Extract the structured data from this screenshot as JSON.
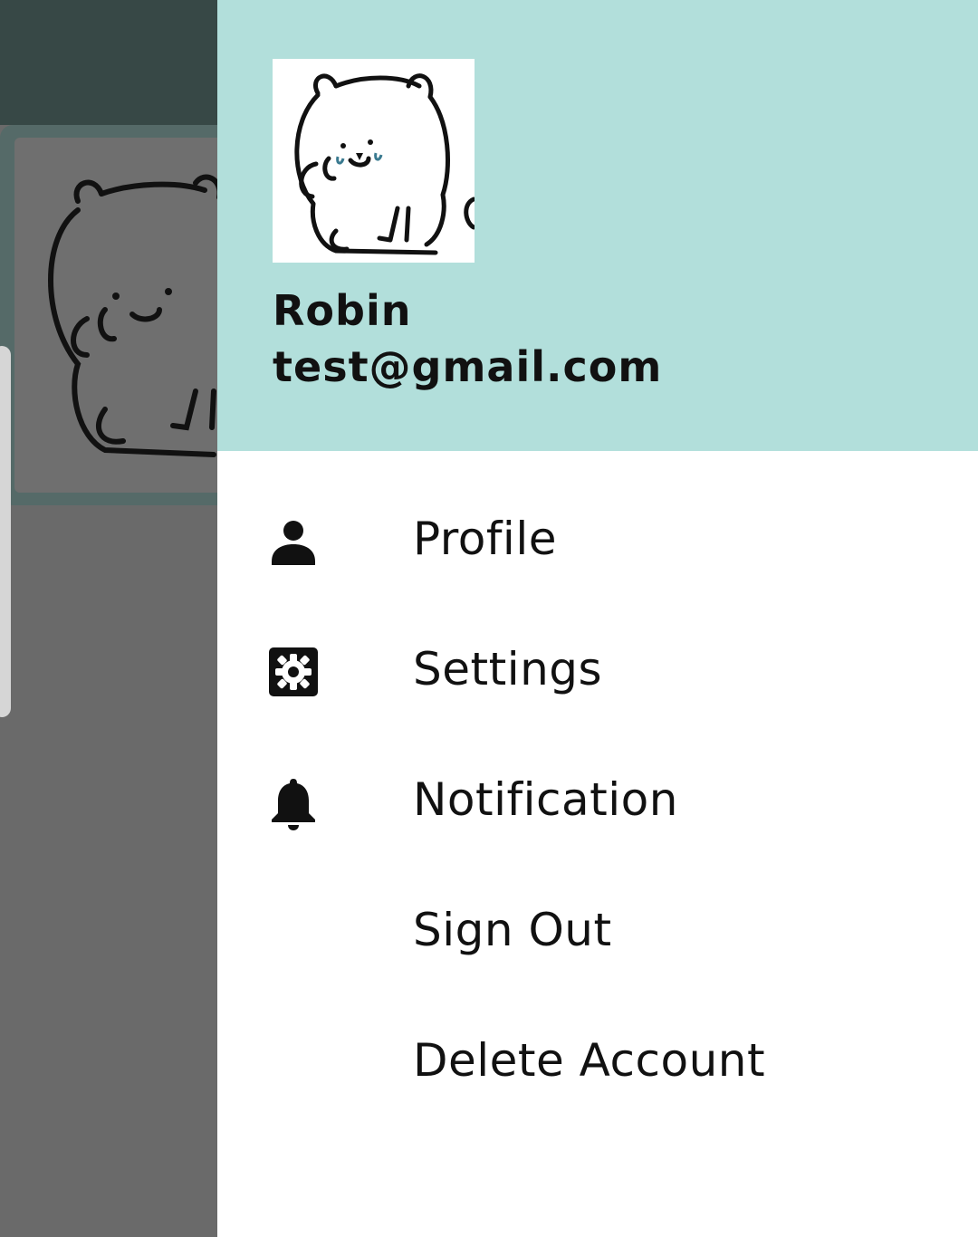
{
  "header": {
    "user_name": "Robin",
    "user_email": "test@gmail.com",
    "avatar_icon": "bear-avatar-icon",
    "background_color": "#b2dfdb"
  },
  "menu": {
    "items": [
      {
        "label": "Profile",
        "icon": "person-icon"
      },
      {
        "label": "Settings",
        "icon": "settings-gear-icon"
      },
      {
        "label": "Notification",
        "icon": "bell-icon"
      },
      {
        "label": "Sign Out",
        "icon": ""
      },
      {
        "label": "Delete Account",
        "icon": ""
      }
    ]
  },
  "colors": {
    "scrim_topbar": "#374846",
    "scrim_content": "#6a6a6a",
    "drawer_background": "#ffffff"
  }
}
